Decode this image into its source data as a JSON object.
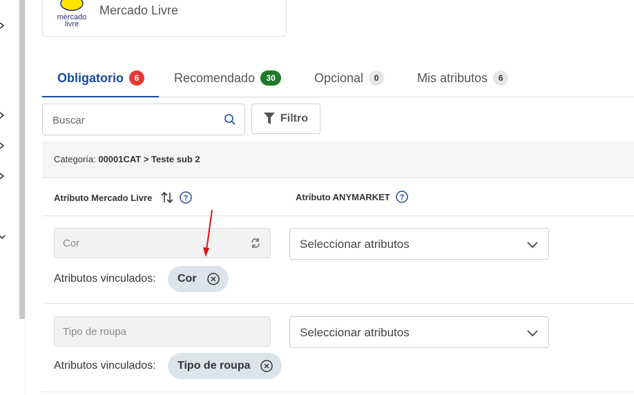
{
  "header": {
    "marketplace_name": "Mercado Livre",
    "logo_text_line1": "mercado",
    "logo_text_line2": "livre"
  },
  "tabs": [
    {
      "label": "Obligatorio",
      "count": "6",
      "active": true,
      "badge_color": "#e53935"
    },
    {
      "label": "Recomendado",
      "count": "30",
      "active": false,
      "badge_color": "#1f7a2b"
    },
    {
      "label": "Opcional",
      "count": "0",
      "active": false,
      "badge_color": "#e6e6e6"
    },
    {
      "label": "Mis atributos",
      "count": "6",
      "active": false,
      "badge_color": "#e6e6e6"
    }
  ],
  "search": {
    "placeholder": "Buscar",
    "filter_label": "Filtro"
  },
  "category": {
    "label": "Categoría:",
    "path": "00001CAT > Teste sub 2"
  },
  "columns": {
    "ml_attribute": "Atributo Mercado Livre",
    "anymarket_attribute": "Atributo ANYMARKET"
  },
  "rows": [
    {
      "ml_value": "Cor",
      "select_placeholder": "Seleccionar atributos",
      "linked_label": "Atributos vinculados:",
      "linked_chip": "Cor"
    },
    {
      "ml_value": "Tipo de roupa",
      "select_placeholder": "Seleccionar atributos",
      "linked_label": "Atributos vinculados:",
      "linked_chip": "Tipo de roupa"
    }
  ],
  "colors": {
    "accent": "#1a4a9c",
    "annotation_arrow": "#e01010"
  }
}
